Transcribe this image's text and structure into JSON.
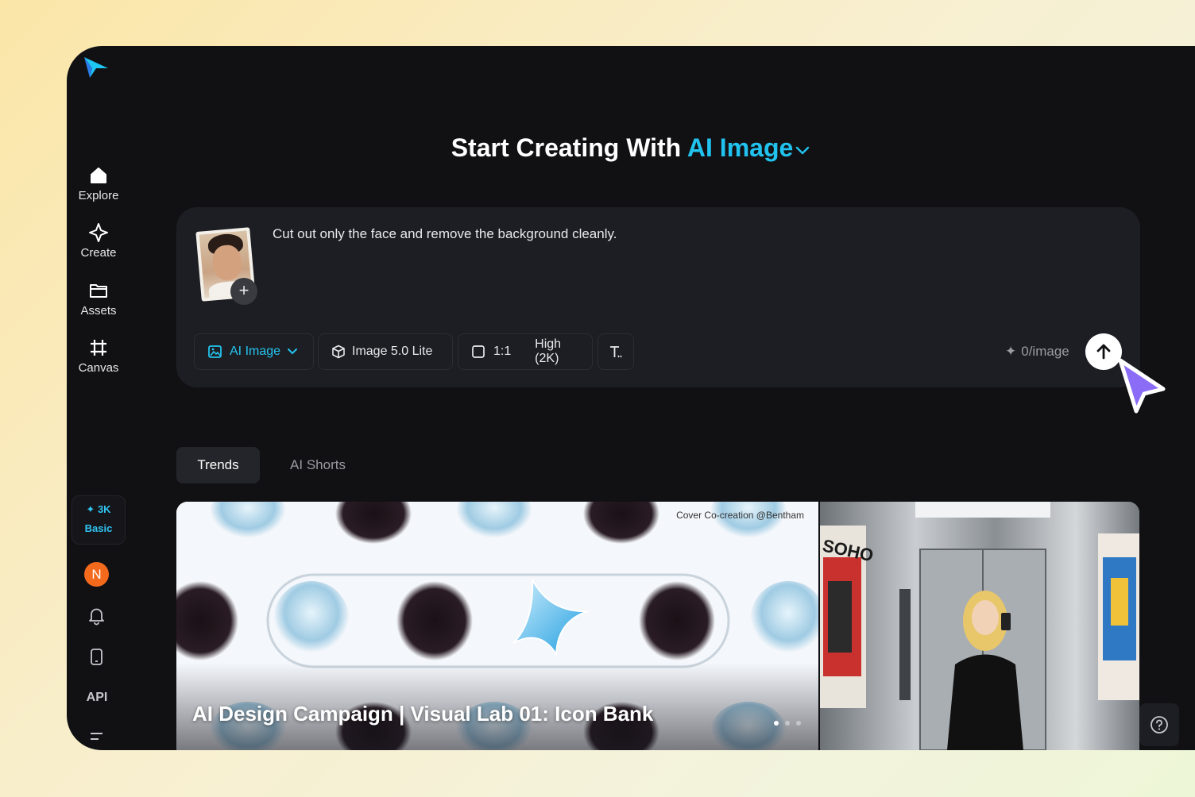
{
  "sidebar": {
    "nav": [
      {
        "label": "Explore",
        "icon": "home-icon"
      },
      {
        "label": "Create",
        "icon": "sparkle-icon"
      },
      {
        "label": "Assets",
        "icon": "folder-icon"
      },
      {
        "label": "Canvas",
        "icon": "frame-icon"
      }
    ],
    "credits": {
      "amount": "3K",
      "plan": "Basic"
    },
    "avatar_initial": "N",
    "api_label": "API"
  },
  "header": {
    "title_prefix": "Start Creating With",
    "title_accent": "AI Image"
  },
  "composer": {
    "prompt": "Cut out only the face and remove the background cleanly.",
    "chips": {
      "mode": "AI Image",
      "model": "Image 5.0 Lite",
      "ratio": "1:1",
      "quality": "High (2K)"
    },
    "cost": "0/image"
  },
  "tabs": [
    {
      "label": "Trends",
      "active": true
    },
    {
      "label": "AI Shorts",
      "active": false
    }
  ],
  "featured": {
    "title": "AI Design Campaign | Visual Lab 01: Icon Bank",
    "credit": "Cover Co-creation @Bentham",
    "side_sign": "SOHO"
  },
  "colors": {
    "accent": "#21c2ee",
    "background": "#111114",
    "panel": "#1d1e23",
    "avatar": "#f46a1c",
    "cursor": "#8b6cf6"
  }
}
